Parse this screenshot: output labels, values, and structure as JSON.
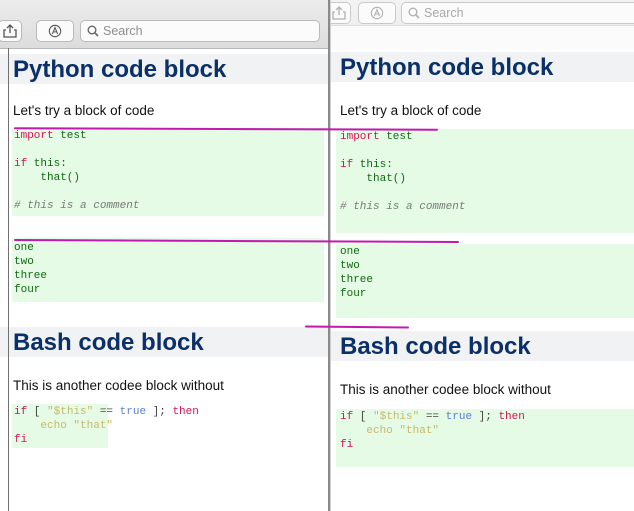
{
  "toolbar": {
    "search_placeholder": "Search",
    "share_icon": "share-icon",
    "reader_icon": "reader-icon"
  },
  "doc": {
    "python_heading": "Python code block",
    "python_intro": "Let's try a block of code",
    "python_code": [
      {
        "kw": "import",
        "rest": " test"
      },
      {
        "kw": "",
        "rest": ""
      },
      {
        "kw": "if",
        "rest": " this:"
      },
      {
        "kw": "",
        "rest": "    that()"
      }
    ],
    "python_comment": "# this is a comment",
    "list_items": [
      "one",
      "two",
      "three",
      "four"
    ],
    "bash_heading": "Bash code block",
    "bash_intro": "This is another codee block without",
    "bash_code": {
      "line1_if": "if",
      "line1_open": " [ ",
      "line1_var": "\"$this\"",
      "line1_op": " == ",
      "line1_bool": "true",
      "line1_close": " ]; ",
      "line1_then": "then",
      "line2": "    echo \"that\"",
      "line3": "fi"
    }
  },
  "colors": {
    "heading": "#0b3068",
    "heading_bg": "#f0f2f4",
    "code_bg": "#e5fbe6",
    "keyword": "#d4145a",
    "annotation_line": "#c21ab0"
  }
}
